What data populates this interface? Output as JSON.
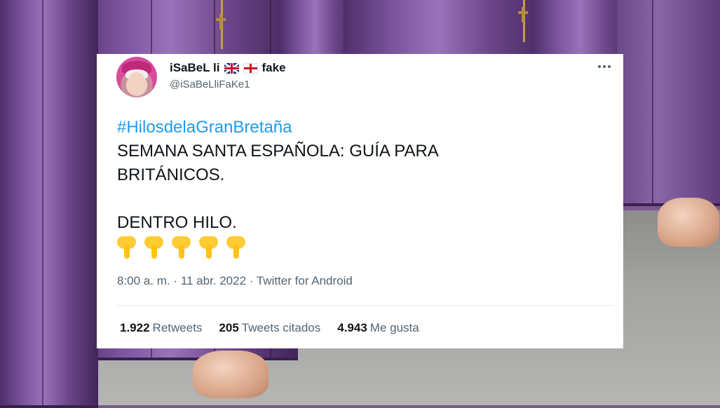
{
  "tweet": {
    "author": {
      "display_name": "iSaBeL li",
      "name_suffix": "fake",
      "handle": "@iSaBeLliFaKe1"
    },
    "hashtag": "#HilosdelaGranBretaña",
    "lines": [
      "SEMANA SANTA ESPAÑOLA: GUÍA PARA",
      "BRITÁNICOS.",
      "DENTRO HILO."
    ],
    "emoji_icon": "backhand-index-pointing-down-icon",
    "emoji_count": 5,
    "time": "8:00 a. m.",
    "separator": "·",
    "date": "11 abr. 2022",
    "source": "Twitter for Android",
    "stats": {
      "retweets_count": "1.922",
      "retweets_label": "Retweets",
      "quotes_count": "205",
      "quotes_label": "Tweets citados",
      "likes_count": "4.943",
      "likes_label": "Me gusta"
    }
  },
  "colors": {
    "hashtag": "#1d9bf0",
    "text": "#0f1419",
    "secondary": "#536471",
    "robe": "#7e56a0"
  }
}
